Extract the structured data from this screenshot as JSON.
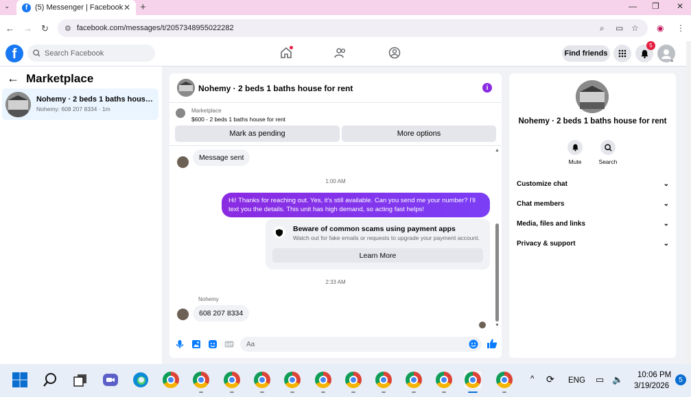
{
  "browser": {
    "tab_title": "(5) Messenger | Facebook",
    "url": "facebook.com/messages/t/2057348955022282"
  },
  "fb": {
    "search_placeholder": "Search Facebook",
    "find_friends": "Find friends",
    "notif_count": "5"
  },
  "left": {
    "header": "Marketplace",
    "conversation": {
      "title": "Nohemy · 2 beds 1 baths house for...",
      "subtitle": "Nohemy: 608 207 8334 · 1m"
    }
  },
  "chat": {
    "title": "Nohemy · 2 beds 1 baths house for rent",
    "marketplace_label": "Marketplace",
    "listing": "$600 - 2 beds 1 baths house for rent",
    "mark_pending": "Mark as pending",
    "more_options": "More options",
    "messages": {
      "m1": "Message sent",
      "t1": "1:00 AM",
      "m2": "Hi! Thanks for reaching out. Yes, it's still available. Can you send me your number? I'll text you the details. This unit has high demand, so acting fast helps!",
      "t2": "2:33 AM",
      "sender": "Nohemy",
      "m3": "608 207 8334"
    },
    "scam": {
      "title": "Beware of common scams using payment apps",
      "subtitle": "Watch out for fake emails or requests to upgrade your payment account.",
      "button": "Learn More"
    },
    "composer_placeholder": "Aa"
  },
  "right": {
    "title": "Nohemy · 2 beds 1 baths house for rent",
    "mute": "Mute",
    "search": "Search",
    "rows": [
      "Customize chat",
      "Chat members",
      "Media, files and links",
      "Privacy & support"
    ]
  },
  "taskbar": {
    "lang": "ENG",
    "time": "10:06 PM",
    "date": "3/19/2026",
    "notif": "5"
  },
  "colors": {
    "accent": "#1877f2",
    "message_purple": "#8a2be2",
    "badge_red": "#e41e3f"
  }
}
